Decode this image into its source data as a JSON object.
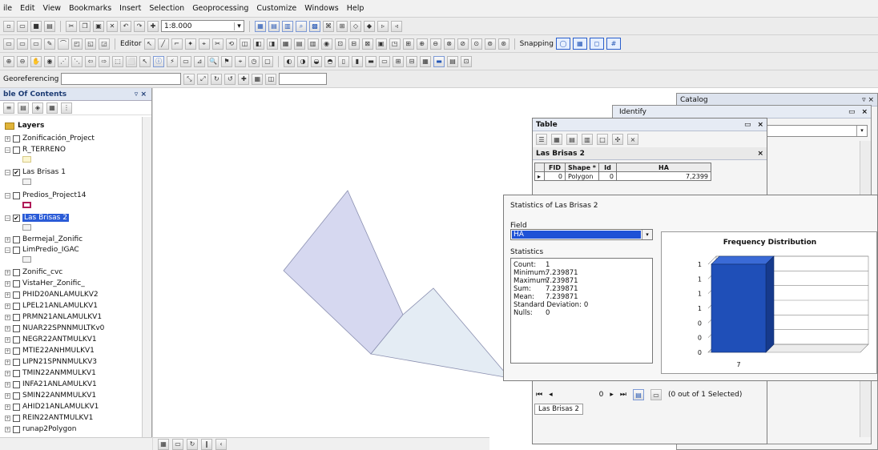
{
  "menu": [
    "ile",
    "Edit",
    "View",
    "Bookmarks",
    "Insert",
    "Selection",
    "Geoprocessing",
    "Customize",
    "Windows",
    "Help"
  ],
  "toolbar": {
    "scale": "1:8.000",
    "editor_label": "Editor",
    "snapping_label": "Snapping",
    "georeferencing_label": "Georeferencing"
  },
  "toc": {
    "title": "ble Of Contents",
    "pin": "▿ ×",
    "root": "Layers",
    "layers": [
      {
        "name": "Zonificación_Project",
        "checked": false,
        "expanded": false
      },
      {
        "name": "R_TERRENO",
        "checked": false,
        "expanded": true
      },
      {
        "name": "Las Brisas 1",
        "checked": true,
        "expanded": true
      },
      {
        "name": "Predios_Project14",
        "checked": false,
        "expanded": true
      },
      {
        "name": "Las Brisas 2",
        "checked": true,
        "expanded": true,
        "selected": true
      },
      {
        "name": "Bermejal_Zonific",
        "checked": false,
        "expanded": false
      },
      {
        "name": "LimPredio_IGAC",
        "checked": false,
        "expanded": true
      },
      {
        "name": "Zonific_cvc",
        "checked": false,
        "expanded": false
      },
      {
        "name": "VistaHer_Zonific_",
        "checked": false,
        "expanded": false
      },
      {
        "name": "PHID20ANLAMULKV2",
        "checked": false,
        "expanded": false
      },
      {
        "name": "LPEL21ANLAMULKV1",
        "checked": false,
        "expanded": false
      },
      {
        "name": "PRMN21ANLAMULKV1",
        "checked": false,
        "expanded": false
      },
      {
        "name": "NUAR22SPNNMULTKv0",
        "checked": false,
        "expanded": false
      },
      {
        "name": "NEGR22ANTMULKV1",
        "checked": false,
        "expanded": false
      },
      {
        "name": "MTIE22ANHMULKV1",
        "checked": false,
        "expanded": false
      },
      {
        "name": "LIPN21SPNNMULKV3",
        "checked": false,
        "expanded": false
      },
      {
        "name": "TMIN22ANMMULKV1",
        "checked": false,
        "expanded": false
      },
      {
        "name": "INFA21ANLAMULKV1",
        "checked": false,
        "expanded": false
      },
      {
        "name": "SMIN22ANMMULKV1",
        "checked": false,
        "expanded": false
      },
      {
        "name": "AHID21ANLAMULKV1",
        "checked": false,
        "expanded": false
      },
      {
        "name": "REIN22ANTMULKV1",
        "checked": false,
        "expanded": false
      },
      {
        "name": "runap2Polygon",
        "checked": false,
        "expanded": false
      }
    ]
  },
  "catalog": {
    "title": "Catalog"
  },
  "identify": {
    "title": "Identify"
  },
  "table_window": {
    "title": "Table",
    "tab_name": "Las Brisas 2",
    "columns": [
      "FID",
      "Shape *",
      "Id",
      "HA"
    ],
    "rows": [
      [
        "0",
        "Polygon",
        "0",
        "7,2399"
      ]
    ],
    "record_nav": {
      "current": "0",
      "status": "(0 out of 1 Selected)"
    },
    "bottom_tab": "Las Brisas 2"
  },
  "stats_window": {
    "title": "Statistics of Las Brisas 2",
    "field_label": "Field",
    "field_value": "HA",
    "statistics_label": "Statistics",
    "lines": [
      {
        "k": "Count:",
        "v": "1"
      },
      {
        "k": "Minimum:",
        "v": "7.239871"
      },
      {
        "k": "Maximum:",
        "v": "7.239871"
      },
      {
        "k": "Sum:",
        "v": "7.239871"
      },
      {
        "k": "Mean:",
        "v": "7.239871"
      },
      {
        "k": "Standard Deviation:",
        "v": "0"
      },
      {
        "k": "Nulls:",
        "v": "0"
      }
    ]
  },
  "chart_data": {
    "type": "bar",
    "title": "Frequency Distribution",
    "categories": [
      "7"
    ],
    "values": [
      1
    ],
    "ytick_labels": [
      "1",
      "1",
      "1",
      "1",
      "0",
      "0",
      "0"
    ],
    "ylim": [
      0,
      1
    ],
    "grid": true,
    "colors": {
      "bar": "#1f4fb8",
      "bar_top": "#3a6ad6",
      "bar_side": "#163a8c"
    }
  },
  "map": {
    "colors": {
      "fill": "#d6d8f0",
      "fill2": "#e4ecf4",
      "stroke": "#8a8fb0"
    }
  }
}
